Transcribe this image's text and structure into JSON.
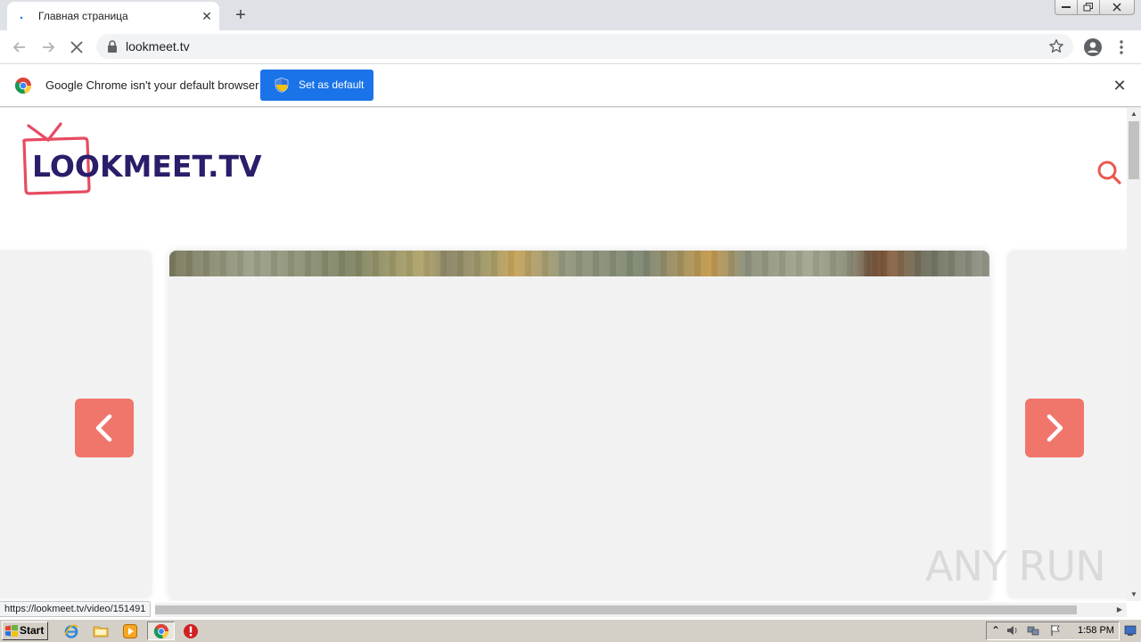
{
  "browser": {
    "tab": {
      "title": "Главная страница"
    },
    "url": "lookmeet.tv",
    "infobar": {
      "message": "Google Chrome isn't your default browser",
      "button_label": "Set as default"
    },
    "status_url": "https://lookmeet.tv/video/151491"
  },
  "site": {
    "logo_text": "LOOKMEET.TV",
    "accent_color": "#f0766c",
    "logo_color": "#2b1d6a"
  },
  "overlay": {
    "watermark_text": "ANY RUN"
  },
  "taskbar": {
    "start_label": "Start",
    "clock": "1:58 PM"
  },
  "icons": {
    "tab": [
      "loading-favicon",
      "close-icon",
      "plus-icon"
    ],
    "toolbar": [
      "back-arrow-icon",
      "forward-arrow-icon",
      "stop-icon",
      "lock-icon",
      "star-icon",
      "account-icon",
      "menu-dots-icon"
    ],
    "page": [
      "tv-icon",
      "search-icon",
      "chevron-left-icon",
      "chevron-right-icon"
    ],
    "taskbar": [
      "windows-logo-icon",
      "ie-icon",
      "folder-icon",
      "media-player-icon",
      "chrome-icon",
      "stop-sign-icon"
    ]
  }
}
